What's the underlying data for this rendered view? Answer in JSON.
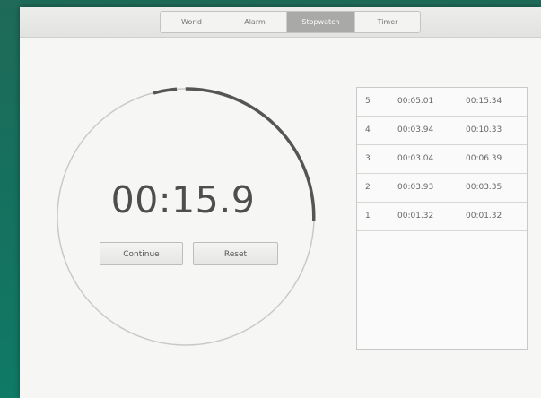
{
  "tabs": [
    {
      "label": "World",
      "active": false
    },
    {
      "label": "Alarm",
      "active": false
    },
    {
      "label": "Stopwatch",
      "active": true
    },
    {
      "label": "Timer",
      "active": false
    }
  ],
  "stopwatch": {
    "time": "00:15.9",
    "continue_label": "Continue",
    "reset_label": "Reset"
  },
  "laps": [
    {
      "number": "5",
      "split": "00:05.01",
      "total": "00:15.34"
    },
    {
      "number": "4",
      "split": "00:03.94",
      "total": "00:10.33"
    },
    {
      "number": "3",
      "split": "00:03.04",
      "total": "00:06.39"
    },
    {
      "number": "2",
      "split": "00:03.93",
      "total": "00:03.35"
    },
    {
      "number": "1",
      "split": "00:01.32",
      "total": "00:01.32"
    }
  ],
  "colors": {
    "active_tab": "#a9aaa7",
    "progress_arc": "#555555",
    "desktop": "#16705e"
  }
}
